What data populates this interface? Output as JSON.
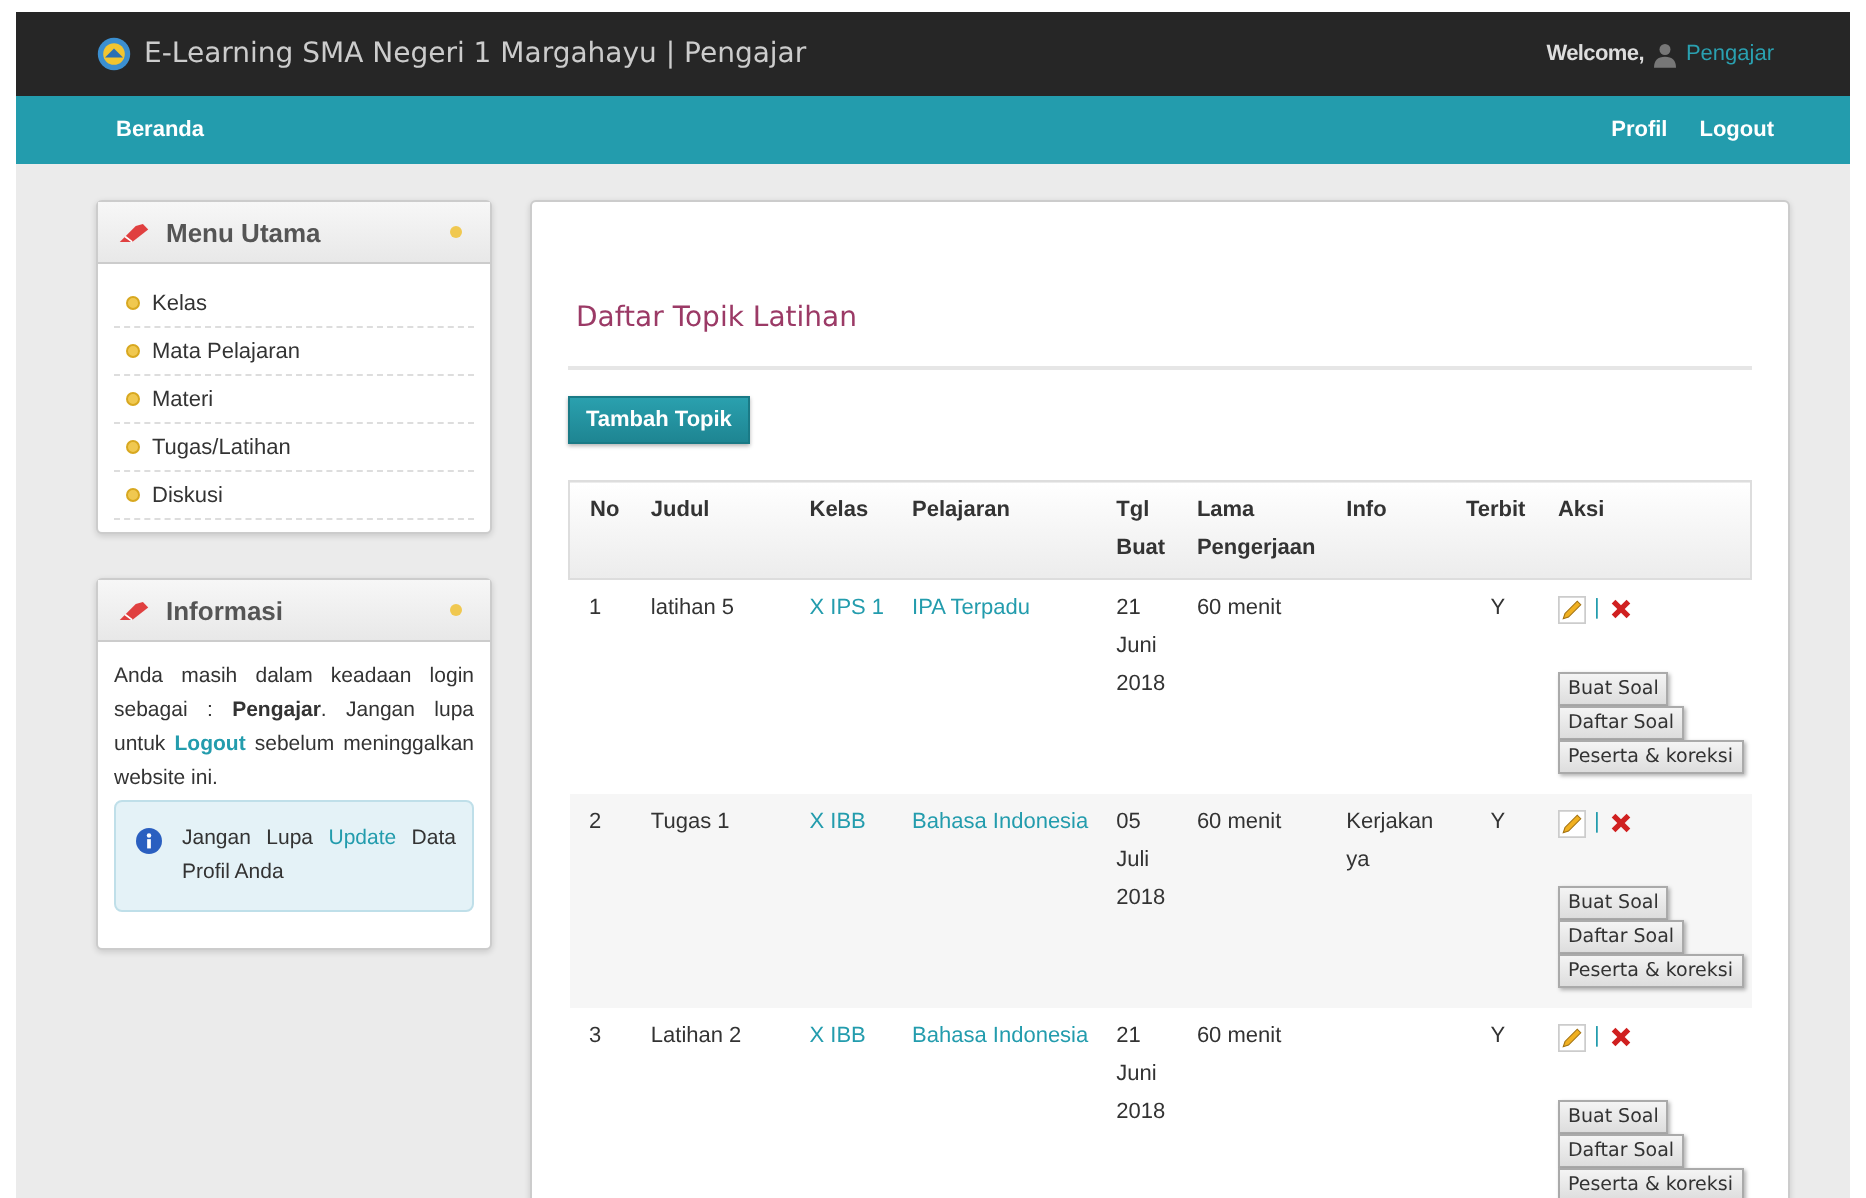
{
  "header": {
    "title": "E-Learning SMA Negeri 1 Margahayu | Pengajar",
    "welcome": "Welcome,",
    "user": "Pengajar"
  },
  "nav": {
    "left": [
      "Beranda"
    ],
    "right": [
      "Profil",
      "Logout"
    ]
  },
  "menu": {
    "title": "Menu Utama",
    "items": [
      "Kelas",
      "Mata Pelajaran",
      "Materi",
      "Tugas/Latihan",
      "Diskusi"
    ]
  },
  "info": {
    "title": "Informasi",
    "line1": "Anda masih dalam keadaan login sebagai : **Pengajar**.",
    "line2_before": "Jangan lupa untuk",
    "line2_link": "Logout",
    "line2_after": "sebelum meninggalkan website ini.",
    "alert_before": "Jangan Lupa",
    "alert_link": "Update",
    "alert_after": "Data Profil Anda"
  },
  "main": {
    "title": "Daftar Topik Latihan",
    "add_button": "Tambah Topik",
    "table": {
      "columns": [
        "No",
        "Judul",
        "Kelas",
        "Pelajaran",
        "Tgl Buat",
        "Lama Pengerjaan",
        "Info",
        "Terbit",
        "Aksi"
      ],
      "rows": [
        {
          "no": "1",
          "judul": "latihan 5",
          "kelas": "X IPS 1",
          "pelajaran": "IPA Terpadu",
          "tgl": "21 Juni 2018",
          "lama": "60 menit",
          "info": "",
          "terbit": "Y",
          "separator": "|",
          "buttons": [
            "Buat Soal",
            "Daftar Soal",
            "Peserta & koreksi"
          ]
        },
        {
          "no": "2",
          "judul": "Tugas 1",
          "kelas": "X IBB",
          "pelajaran": "Bahasa Indonesia",
          "tgl": "05 Juli 2018",
          "lama": "60 menit",
          "info": "Kerjakan ya",
          "terbit": "Y",
          "separator": "|",
          "buttons": [
            "Buat Soal",
            "Daftar Soal",
            "Peserta & koreksi"
          ]
        },
        {
          "no": "3",
          "judul": "Latihan 2",
          "kelas": "X IBB",
          "pelajaran": "Bahasa Indonesia",
          "tgl": "21 Juni 2018",
          "lama": "60 menit",
          "info": "",
          "terbit": "Y",
          "separator": "|",
          "buttons": [
            "Buat Soal",
            "Daftar Soal",
            "Peserta & koreksi"
          ]
        }
      ]
    }
  }
}
